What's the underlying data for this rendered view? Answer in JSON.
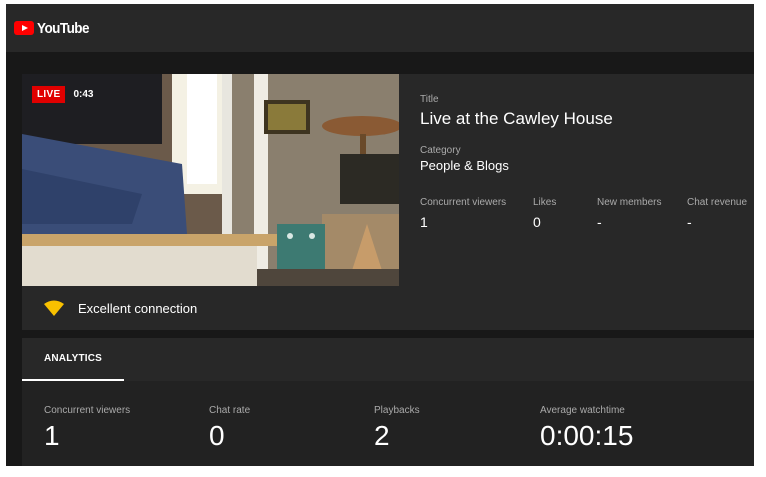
{
  "header": {
    "logo_text": "YouTube"
  },
  "stream": {
    "live_badge": "LIVE",
    "elapsed": "0:43",
    "title_label": "Title",
    "title": "Live at the Cawley House",
    "category_label": "Category",
    "category": "People & Blogs",
    "stats": [
      {
        "label": "Concurrent viewers",
        "value": "1"
      },
      {
        "label": "Likes",
        "value": "0"
      },
      {
        "label": "New members",
        "value": "-"
      },
      {
        "label": "Chat revenue",
        "value": "-"
      }
    ],
    "connection": "Excellent connection",
    "connection_color": "#f9c100"
  },
  "analytics": {
    "tab_label": "ANALYTICS",
    "metrics": [
      {
        "label": "Concurrent viewers",
        "value": "1"
      },
      {
        "label": "Chat rate",
        "value": "0"
      },
      {
        "label": "Playbacks",
        "value": "2"
      },
      {
        "label": "Average watchtime",
        "value": "0:00:15"
      }
    ]
  }
}
